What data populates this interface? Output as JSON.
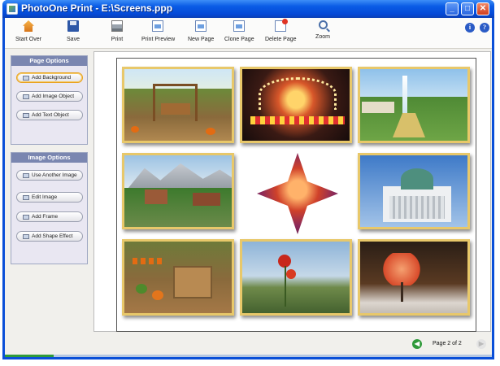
{
  "window": {
    "title": "PhotoOne Print - E:\\Screens.ppp"
  },
  "titlebar_buttons": {
    "minimize": "_",
    "maximize": "□",
    "close": "✕"
  },
  "toolbar": {
    "items": [
      {
        "label": "Start Over",
        "icon": "home-icon"
      },
      {
        "label": "Save",
        "icon": "floppy-icon"
      },
      {
        "label": "Print",
        "icon": "printer-icon"
      },
      {
        "label": "Print Preview",
        "icon": "print-preview-icon"
      },
      {
        "label": "New Page",
        "icon": "new-page-icon"
      },
      {
        "label": "Clone Page",
        "icon": "clone-page-icon"
      },
      {
        "label": "Delete Page",
        "icon": "delete-page-icon"
      },
      {
        "label": "Zoom",
        "icon": "zoom-icon"
      }
    ],
    "info_glyph": "i",
    "help_glyph": "?"
  },
  "page_options": {
    "title": "Page Options",
    "buttons": [
      "Add Background",
      "Add Image Object",
      "Add Text Object"
    ],
    "active_index": 0
  },
  "image_options": {
    "title": "Image Options",
    "buttons": [
      "Use Another Image",
      "Edit Image",
      "Add Frame",
      "Add Shape Effect"
    ]
  },
  "canvas": {
    "photos": [
      {
        "subject": "garden-swing-photo"
      },
      {
        "subject": "carnival-ride-photo"
      },
      {
        "subject": "fountain-palace-photo"
      },
      {
        "subject": "mountain-village-photo"
      },
      {
        "subject": "diamond-shaped-statue-photo"
      },
      {
        "subject": "domed-cathedral-photo"
      },
      {
        "subject": "pumpkin-patch-photo"
      },
      {
        "subject": "red-flowers-photo"
      },
      {
        "subject": "autumn-tree-photo"
      }
    ]
  },
  "status": {
    "page_indicator": "Page 2 of 2",
    "prev_glyph": "◀",
    "next_glyph": "▶",
    "progress": 0.1
  },
  "colors": {
    "title_bar": "#0a5ce6",
    "frame_gold": "#e8c86a",
    "panel_header": "#7a86b0",
    "active_button_border": "#e8a21f",
    "progress_fill": "#2f9a3a"
  }
}
